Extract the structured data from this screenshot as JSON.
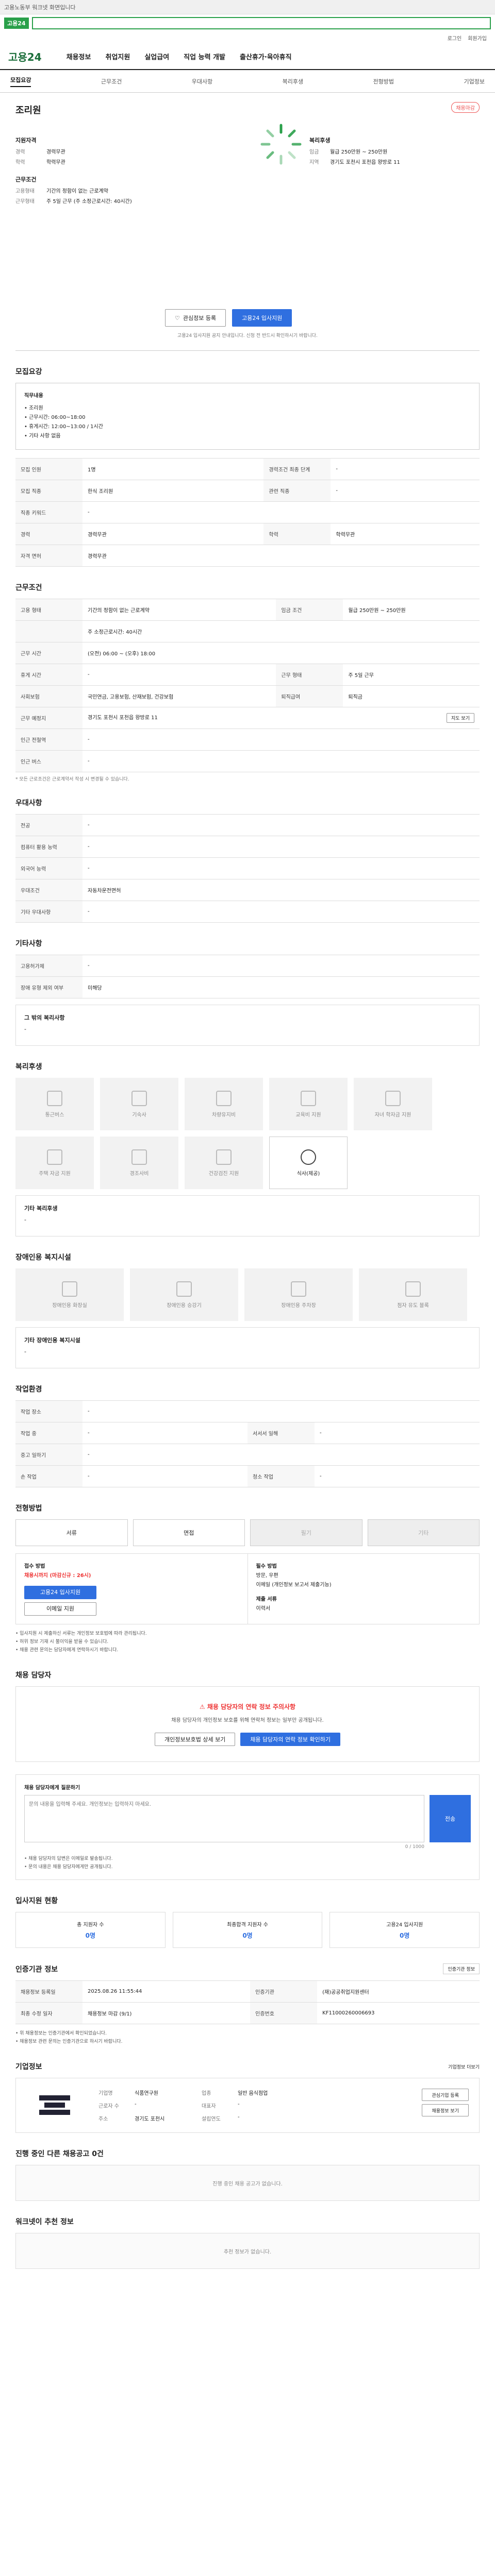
{
  "topbar": {
    "text": "고용노동부 워크넷 화면입니다"
  },
  "search": {
    "logo": "고용24",
    "query": ""
  },
  "util": {
    "items": [
      "로그인",
      "회원가입"
    ]
  },
  "gnb": {
    "brand": "고용24",
    "menu": [
      "채용정보",
      "취업지원",
      "실업급여",
      "직업 능력 개발",
      "출산휴가·육아휴직"
    ]
  },
  "tabs": [
    "모집요강",
    "근무조건",
    "우대사항",
    "복리후생",
    "전형방법",
    "기업정보"
  ],
  "header": {
    "company": "조리원",
    "badge": "채용마감",
    "groups": [
      {
        "title": "지원자격",
        "rows": [
          [
            "경력",
            "경력무관"
          ],
          [
            "학력",
            "학력무관"
          ]
        ]
      },
      {
        "title": "근무조건",
        "rows": [
          [
            "고용형태",
            "기간의 정함이 없는 근로계약"
          ],
          [
            "근무형태",
            "주 5일 근무 (주 소정근로시간: 40시간)"
          ]
        ]
      }
    ],
    "right": {
      "title": "복리후생",
      "rows": [
        [
          "임금",
          "월급 250만원 ~ 250만원"
        ],
        [
          "지역",
          "경기도 포천시 포천읍 왕방로 11"
        ]
      ]
    },
    "btn_save": "관심정보 등록",
    "btn_apply": "고용24 입사지원",
    "notice": "고용24 입사지원 공지 안내입니다. 신청 전 반드시 확인하시기 바랍니다."
  },
  "recruit": {
    "title": "모집요강",
    "note_title": "직무내용",
    "note_lines": [
      "• 조리원",
      "• 근무시간: 06:00~18:00",
      "• 휴게시간: 12:00~13:00 / 1시간",
      "• 기타 사항 없음"
    ],
    "rows": [
      [
        "모집 인원",
        "1명",
        "경력조건 최종 단계",
        "-"
      ],
      [
        "모집 직종",
        "한식 조리원",
        "관련 직종",
        "-"
      ],
      [
        "직종 키워드",
        "-",
        "",
        ""
      ],
      [
        "경력",
        "경력무관",
        "학력",
        "학력무관"
      ],
      [
        "자격 면허",
        "경력무관",
        "",
        ""
      ]
    ]
  },
  "work": {
    "title": "근무조건",
    "rows": [
      [
        "고용 형태",
        "기간의 정함이 없는 근로계약",
        "임금 조건",
        "월급 250만원 ~ 250만원"
      ],
      [
        "",
        "주 소정근로시간: 40시간",
        "",
        ""
      ],
      [
        "근무 시간",
        "(오전) 06:00 ~ (오후) 18:00",
        "",
        ""
      ],
      [
        "휴게 시간",
        "-",
        "근무 형태",
        "주 5일 근무"
      ],
      [
        "사회보험",
        "국민연금, 고용보험, 산재보험, 건강보험",
        "퇴직급여",
        "퇴직금"
      ],
      [
        "근무 예정지",
        "경기도 포천시 포천읍 왕방로 11",
        "",
        ""
      ],
      [
        "인근 전철역",
        "-",
        "",
        ""
      ],
      [
        "인근 버스",
        "-",
        "",
        ""
      ]
    ],
    "map_btn": "지도 보기",
    "footnote": "* 모든 근로조건은 근로계약서 작성 시 변경될 수 있습니다."
  },
  "pref": {
    "title": "우대사항",
    "rows": [
      [
        "전공",
        "-"
      ],
      [
        "컴퓨터 활용 능력",
        "-"
      ],
      [
        "외국어 능력",
        "-"
      ],
      [
        "우대조건",
        "자동차운전면허"
      ],
      [
        "기타 우대사항",
        "-"
      ]
    ]
  },
  "other": {
    "title": "기타사항",
    "rows": [
      [
        "고용허가제",
        "-"
      ],
      [
        "장애 유형 제외 여부",
        "미해당"
      ]
    ],
    "extra_title": "그 밖의 복리사항",
    "extra_value": "-"
  },
  "welfare": {
    "title": "복리후생",
    "items": [
      {
        "label": "통근버스",
        "on": false
      },
      {
        "label": "기숙사",
        "on": false
      },
      {
        "label": "차량유지비",
        "on": false
      },
      {
        "label": "교육비 지원",
        "on": false
      },
      {
        "label": "자녀 학자금 지원",
        "on": false
      },
      {
        "label": "주택 자금 지원",
        "on": false
      },
      {
        "label": "경조사비",
        "on": false
      },
      {
        "label": "건강검진 지원",
        "on": false
      },
      {
        "label": "식사(제공)",
        "on": true
      }
    ],
    "other_title": "기타 복리후생",
    "other_value": "-"
  },
  "disability": {
    "title": "장애인용 복지시설",
    "items": [
      "장애인용 화장실",
      "장애인용 승강기",
      "장애인용 주차장",
      "점자 유도 블록"
    ],
    "other_title": "기타 장애인용 복지시설",
    "other_value": "-"
  },
  "env": {
    "title": "작업환경",
    "rows": [
      [
        "작업 장소",
        "-",
        "",
        ""
      ],
      [
        "작업 중",
        "-",
        "서서서 일해",
        "-"
      ],
      [
        "중고 일하기",
        "-",
        "",
        ""
      ],
      [
        "손 작업",
        "-",
        "청소 작업",
        "-"
      ]
    ]
  },
  "screen": {
    "title": "전형방법",
    "tabs": [
      {
        "label": "서류",
        "dis": false
      },
      {
        "label": "면접",
        "dis": false
      },
      {
        "label": "필기",
        "dis": true
      },
      {
        "label": "기타",
        "dis": true
      }
    ],
    "left_title": "접수 방법",
    "left_red": "채용시까지 (마감신규 : 26시)",
    "apply_btn": "고용24 입사지원",
    "email_btn": "이메일 지원",
    "right_title": "필수 방법",
    "right_lines": [
      "방문, 우편",
      "이메일 (개인정보 보고서 제출기능)"
    ],
    "right_title2": "제출 서류",
    "right_value": "이력서",
    "bullets": [
      "• 입사지원 시 제출하신 서류는 개인정보 보호법에 따라 관리됩니다.",
      "• 허위 정보 기재 시 불이익을 받을 수 있습니다.",
      "• 채용 관련 문의는 담당자에게 연락하시기 바랍니다."
    ]
  },
  "manager": {
    "title": "채용 담당자",
    "warn": "채용 담당자의 연락 정보 주의사항",
    "txt": "채용 담당자의 개인정보 보호를 위해 연락처 정보는 일부만 공개됩니다.",
    "btn1": "개인정보보호법 상세 보기",
    "btn2": "채용 담당자의 연락 정보 확인하기"
  },
  "inquiry": {
    "title": "채용 담당자에게 질문하기",
    "count": "0 / 1000",
    "placeholder": "문의 내용을 입력해 주세요. 개인정보는 입력하지 마세요.",
    "send": "전송",
    "notes": [
      "• 채용 담당자의 답변은 이메일로 발송됩니다.",
      "• 문의 내용은 채용 담당자에게만 공개됩니다."
    ]
  },
  "applicants": {
    "title": "입사지원 현황",
    "stats": [
      [
        "총 지원자 수",
        "0명"
      ],
      [
        "최종합격 지원자 수",
        "0명"
      ],
      [
        "고용24 입사지원",
        "0명"
      ]
    ]
  },
  "history": {
    "title": "인증기관 정보",
    "btn": "인증기관 정보",
    "rows": [
      [
        "채용정보 등록일",
        "2025.08.26 11:55:44",
        "인증기관",
        "(재)공공취업지원센터"
      ],
      [
        "최종 수정 일자",
        "채용정보 마감 (9/1)",
        "인증번호",
        "KF11000260006693"
      ]
    ],
    "notes": [
      "• 위 채용정보는 인증기관에서 확인되었습니다.",
      "• 채용정보 관련 문의는 인증기관으로 하시기 바랍니다."
    ]
  },
  "company": {
    "title": "기업정보",
    "more": "기업정보 더보기",
    "cols": [
      [
        "기업명",
        "식품연구원"
      ],
      [
        "업종",
        "일반 음식점업"
      ],
      [
        "근로자 수",
        "-"
      ],
      [
        "대표자",
        "-"
      ],
      [
        "주소",
        "경기도 포천시"
      ],
      [
        "설립연도",
        "-"
      ]
    ],
    "btn_a": "관심기업 등록",
    "btn_b": "채용정보 보기"
  },
  "other_jobs": {
    "title": "진행 중인 다른 채용공고 0건",
    "empty": "진행 중인 채용 공고가 없습니다."
  },
  "recommend": {
    "title": "워크넷이 추천 정보",
    "empty": "추천 정보가 없습니다."
  }
}
